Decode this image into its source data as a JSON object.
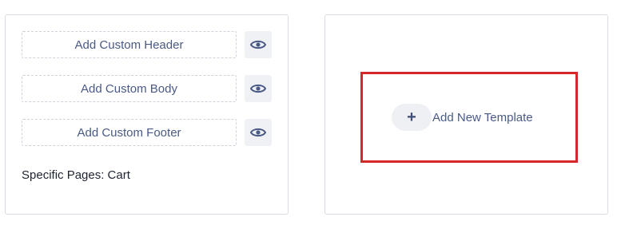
{
  "left_card": {
    "slots": [
      {
        "label": "Add Custom Header",
        "icon": "eye-icon"
      },
      {
        "label": "Add Custom Body",
        "icon": "eye-icon"
      },
      {
        "label": "Add Custom Footer",
        "icon": "eye-icon"
      }
    ],
    "condition_text": "Specific Pages: Cart"
  },
  "right_card": {
    "add_template_label": "Add New Template",
    "add_icon": "plus-icon",
    "plus_glyph": "+"
  },
  "colors": {
    "accent_text": "#4a5a85",
    "highlight_border": "#d4262b",
    "card_border": "#d9dce3"
  }
}
